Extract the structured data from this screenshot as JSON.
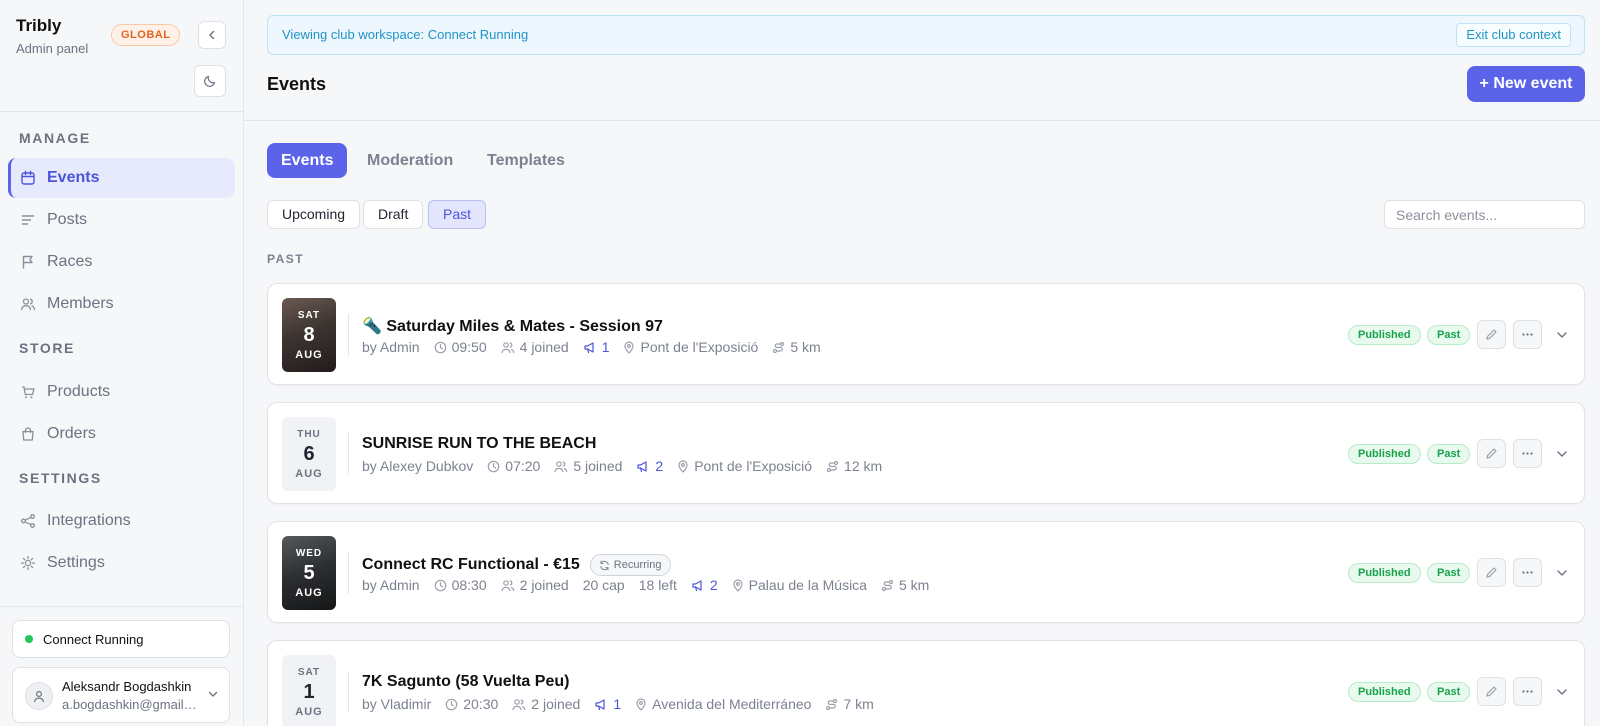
{
  "brand": {
    "name": "Tribly",
    "subtitle": "Admin panel",
    "badge": "GLOBAL"
  },
  "sidebar": {
    "sections": {
      "manage": "MANAGE",
      "store": "STORE",
      "settings": "SETTINGS"
    },
    "items": {
      "events": {
        "label": "Events",
        "icon": "calendar-icon"
      },
      "posts": {
        "label": "Posts",
        "icon": "lines-icon"
      },
      "races": {
        "label": "Races",
        "icon": "flag-icon"
      },
      "members": {
        "label": "Members",
        "icon": "users-icon"
      },
      "products": {
        "label": "Products",
        "icon": "cart-icon"
      },
      "orders": {
        "label": "Orders",
        "icon": "bag-icon"
      },
      "integrations": {
        "label": "Integrations",
        "icon": "share-icon"
      },
      "settings": {
        "label": "Settings",
        "icon": "sun-gear-icon"
      }
    },
    "club": "Connect Running",
    "user": {
      "name": "Aleksandr Bogdashkin",
      "email": "a.bogdashkin@gmail.com"
    }
  },
  "banner": {
    "text": "Viewing club workspace: Connect Running",
    "exit_label": "Exit club context"
  },
  "header": {
    "title": "Events",
    "new_event_label": "+ New event"
  },
  "tabs": [
    "Events",
    "Moderation",
    "Templates"
  ],
  "filters": [
    "Upcoming",
    "Draft",
    "Past"
  ],
  "search": {
    "placeholder": "Search events..."
  },
  "section_label": "PAST",
  "colors": {
    "accent": "#5b63e8",
    "success": "#17a34a",
    "info": "#1e94c8",
    "warning": "#e0651e"
  },
  "events": [
    {
      "dow": "SAT",
      "day": "8",
      "month": "AUG",
      "title": "🔦 Saturday Miles & Mates - Session 97",
      "by": "by Admin",
      "time": "09:50",
      "joined": "4 joined",
      "announcements": "1",
      "location": "Pont de l'Exposició",
      "distance": "5 km",
      "status": "Published",
      "phase": "Past"
    },
    {
      "dow": "THU",
      "day": "6",
      "month": "AUG",
      "title": "SUNRISE RUN TO THE BEACH",
      "by": "by Alexey Dubkov",
      "time": "07:20",
      "joined": "5 joined",
      "announcements": "2",
      "location": "Pont de l'Exposició",
      "distance": "12 km",
      "status": "Published",
      "phase": "Past"
    },
    {
      "dow": "WED",
      "day": "5",
      "month": "AUG",
      "title": "Connect RC Functional - €15",
      "recurring": "Recurring",
      "by": "by Admin",
      "time": "08:30",
      "joined": "2 joined",
      "cap": "20 cap",
      "left": "18 left",
      "announcements": "2",
      "location": "Palau de la Música",
      "distance": "5 km",
      "status": "Published",
      "phase": "Past"
    },
    {
      "dow": "SAT",
      "day": "1",
      "month": "AUG",
      "title": "7K Sagunto (58 Vuelta Peu)",
      "by": "by Vladimir",
      "time": "20:30",
      "joined": "2 joined",
      "announcements": "1",
      "location": "Avenida del Mediterráneo",
      "distance": "7 km",
      "status": "Published",
      "phase": "Past"
    }
  ]
}
